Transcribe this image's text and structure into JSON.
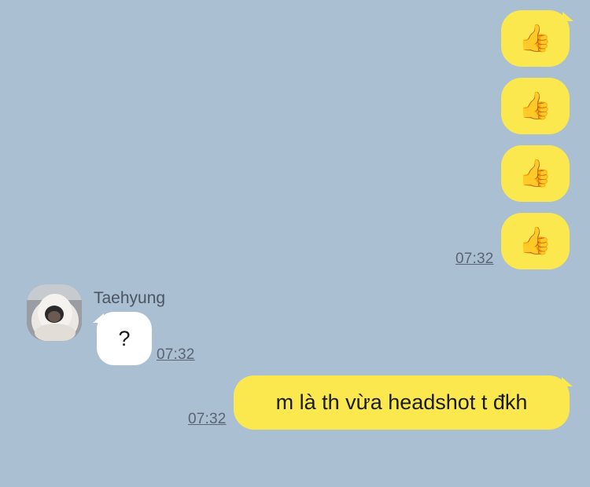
{
  "chat": {
    "outgoing_reactions": [
      {
        "emoji": "👍",
        "icon": "thumbs-up-icon"
      },
      {
        "emoji": "👍",
        "icon": "thumbs-up-icon"
      },
      {
        "emoji": "👍",
        "icon": "thumbs-up-icon"
      },
      {
        "emoji": "👍",
        "icon": "thumbs-up-icon"
      }
    ],
    "outgoing_reactions_time": "07:32",
    "incoming": {
      "sender": "Taehyung",
      "text": "?",
      "time": "07:32"
    },
    "outgoing_text": {
      "text": "m là th vừa headshot t đkh",
      "time": "07:32"
    }
  },
  "colors": {
    "background": "#abbfd3",
    "outgoing_bubble": "#fbe84e",
    "incoming_bubble": "#ffffff",
    "timestamp": "#5a6472"
  }
}
